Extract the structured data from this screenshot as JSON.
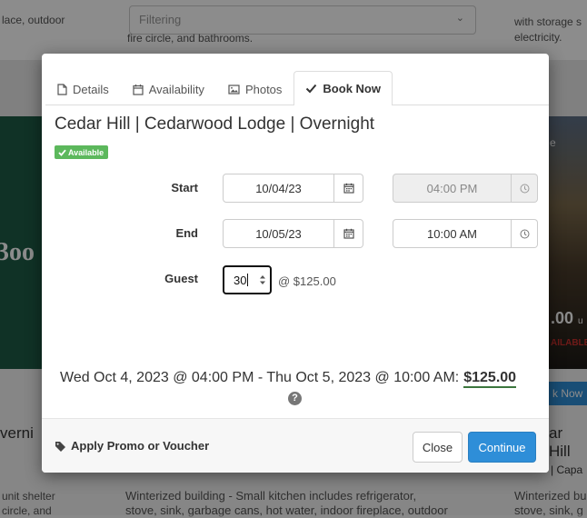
{
  "background": {
    "filter_placeholder": "Filtering",
    "text_top_left": "lace, outdoor",
    "text_top_mid": "fire circle, and bathrooms.",
    "text_top_right_1": "with storage s",
    "text_top_right_2": "electricity.",
    "green_card_text": "3oo",
    "photo_card_text": "e",
    "photo_price": ".00",
    "photo_price_unit": "u",
    "photo_availability": "AILABLE",
    "photo_book_label": "k Now",
    "card_title_left": "verni",
    "card_title_right": "ar Hill",
    "card_capacity_right": "| Capa",
    "text_bottom_left_1": "unit shelter",
    "text_bottom_left_2": "circle, and",
    "text_bottom_mid_1": "Winterized building - Small kitchen includes refrigerator,",
    "text_bottom_mid_2": "stove, sink, garbage cans, hot water, indoor fireplace, outdoor",
    "text_bottom_right_1": "Winterized bu",
    "text_bottom_right_2": "stove, sink, g"
  },
  "modal": {
    "tabs": [
      {
        "label": "Details",
        "icon": "file-icon",
        "active": false
      },
      {
        "label": "Availability",
        "icon": "calendar-icon",
        "active": false
      },
      {
        "label": "Photos",
        "icon": "image-icon",
        "active": false
      },
      {
        "label": "Book Now",
        "icon": "check-icon",
        "active": true
      }
    ],
    "title": "Cedar Hill | Cedarwood Lodge | Overnight",
    "status_badge": "Available",
    "form": {
      "start_label": "Start",
      "start_date": "10/04/23",
      "start_time": "04:00 PM",
      "end_label": "End",
      "end_date": "10/05/23",
      "end_time": "10:00 AM",
      "guest_label": "Guest",
      "guest_value": "30",
      "rate_text": "@ $125.00"
    },
    "summary_text": "Wed Oct 4, 2023 @ 04:00 PM - Thu Oct 5, 2023 @ 10:00 AM:",
    "summary_total": "$125.00",
    "footer": {
      "promo_label": "Apply Promo or Voucher",
      "close_label": "Close",
      "continue_label": "Continue"
    }
  },
  "colors": {
    "primary": "#2e8ed8",
    "success": "#5cb85c",
    "total_underline": "#3c763d"
  }
}
